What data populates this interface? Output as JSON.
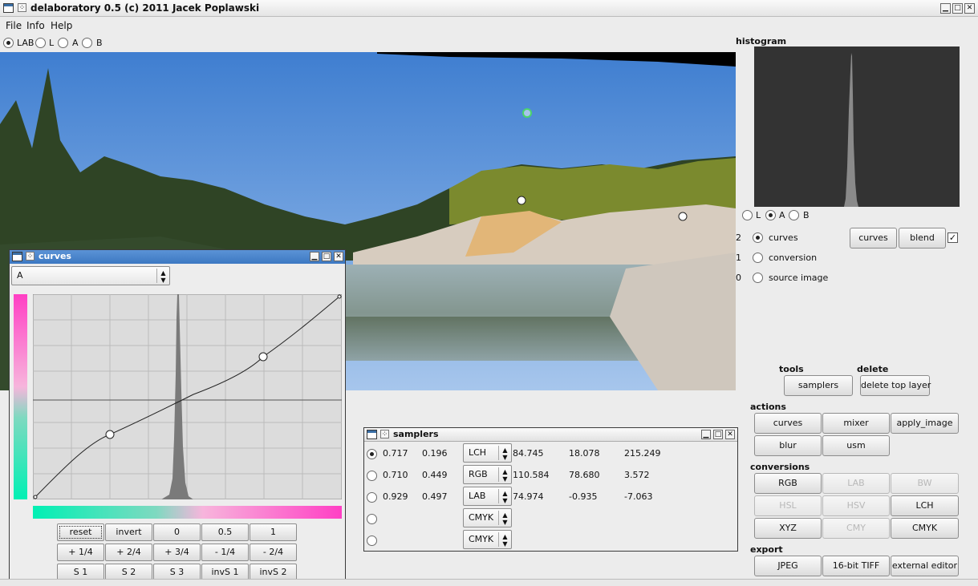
{
  "app": {
    "title": "delaboratory 0.5 (c) 2011 Jacek Poplawski"
  },
  "menu": [
    "File",
    "Info",
    "Help"
  ],
  "view_channels": {
    "options": [
      "LAB",
      "L",
      "A",
      "B"
    ],
    "selected": "LAB"
  },
  "histogram": {
    "title": "histogram",
    "channels": [
      "L",
      "A",
      "B"
    ],
    "selected": "A"
  },
  "layers": [
    {
      "index": "2",
      "name": "curves",
      "selected": true
    },
    {
      "index": "1",
      "name": "conversion",
      "selected": false
    },
    {
      "index": "0",
      "name": "source image",
      "selected": false
    }
  ],
  "layer_buttons": {
    "curves": "curves",
    "blend": "blend",
    "enabled": true
  },
  "tools": {
    "title": "tools",
    "samplers": "samplers"
  },
  "delete": {
    "title": "delete",
    "button": "delete top layer"
  },
  "actions": {
    "title": "actions",
    "buttons": [
      "curves",
      "mixer",
      "apply_image",
      "blur",
      "usm"
    ]
  },
  "conversions": {
    "title": "conversions",
    "buttons": [
      {
        "label": "RGB",
        "enabled": true
      },
      {
        "label": "LAB",
        "enabled": false
      },
      {
        "label": "BW",
        "enabled": false
      },
      {
        "label": "HSL",
        "enabled": false
      },
      {
        "label": "HSV",
        "enabled": false
      },
      {
        "label": "LCH",
        "enabled": true
      },
      {
        "label": "XYZ",
        "enabled": true
      },
      {
        "label": "CMY",
        "enabled": false
      },
      {
        "label": "CMYK",
        "enabled": true
      }
    ]
  },
  "export": {
    "title": "export",
    "buttons": [
      "JPEG",
      "16-bit TIFF",
      "external editor"
    ]
  },
  "curves_window": {
    "title": "curves",
    "channel": "A",
    "buttons": [
      [
        "reset",
        "invert",
        "0",
        "0.5",
        "1"
      ],
      [
        "+ 1/4",
        "+ 2/4",
        "+ 3/4",
        "- 1/4",
        "- 2/4"
      ],
      [
        "S 1",
        "S 2",
        "S 3",
        "invS 1",
        "invS 2"
      ]
    ]
  },
  "samplers_window": {
    "title": "samplers",
    "rows": [
      {
        "selected": true,
        "x": "0.717",
        "y": "0.196",
        "space": "LCH",
        "v1": "84.745",
        "v2": "18.078",
        "v3": "215.249"
      },
      {
        "selected": false,
        "x": "0.710",
        "y": "0.449",
        "space": "RGB",
        "v1": "110.584",
        "v2": "78.680",
        "v3": "3.572"
      },
      {
        "selected": false,
        "x": "0.929",
        "y": "0.497",
        "space": "LAB",
        "v1": "74.974",
        "v2": "-0.935",
        "v3": "-7.063"
      },
      {
        "selected": false,
        "x": "",
        "y": "",
        "space": "CMYK",
        "v1": "",
        "v2": "",
        "v3": ""
      },
      {
        "selected": false,
        "x": "",
        "y": "",
        "space": "CMYK",
        "v1": "",
        "v2": "",
        "v3": ""
      }
    ]
  },
  "colors": {
    "title_active": "#3c78c2",
    "accent_pink": "#ff3fc4",
    "accent_teal": "#00f0b4"
  }
}
